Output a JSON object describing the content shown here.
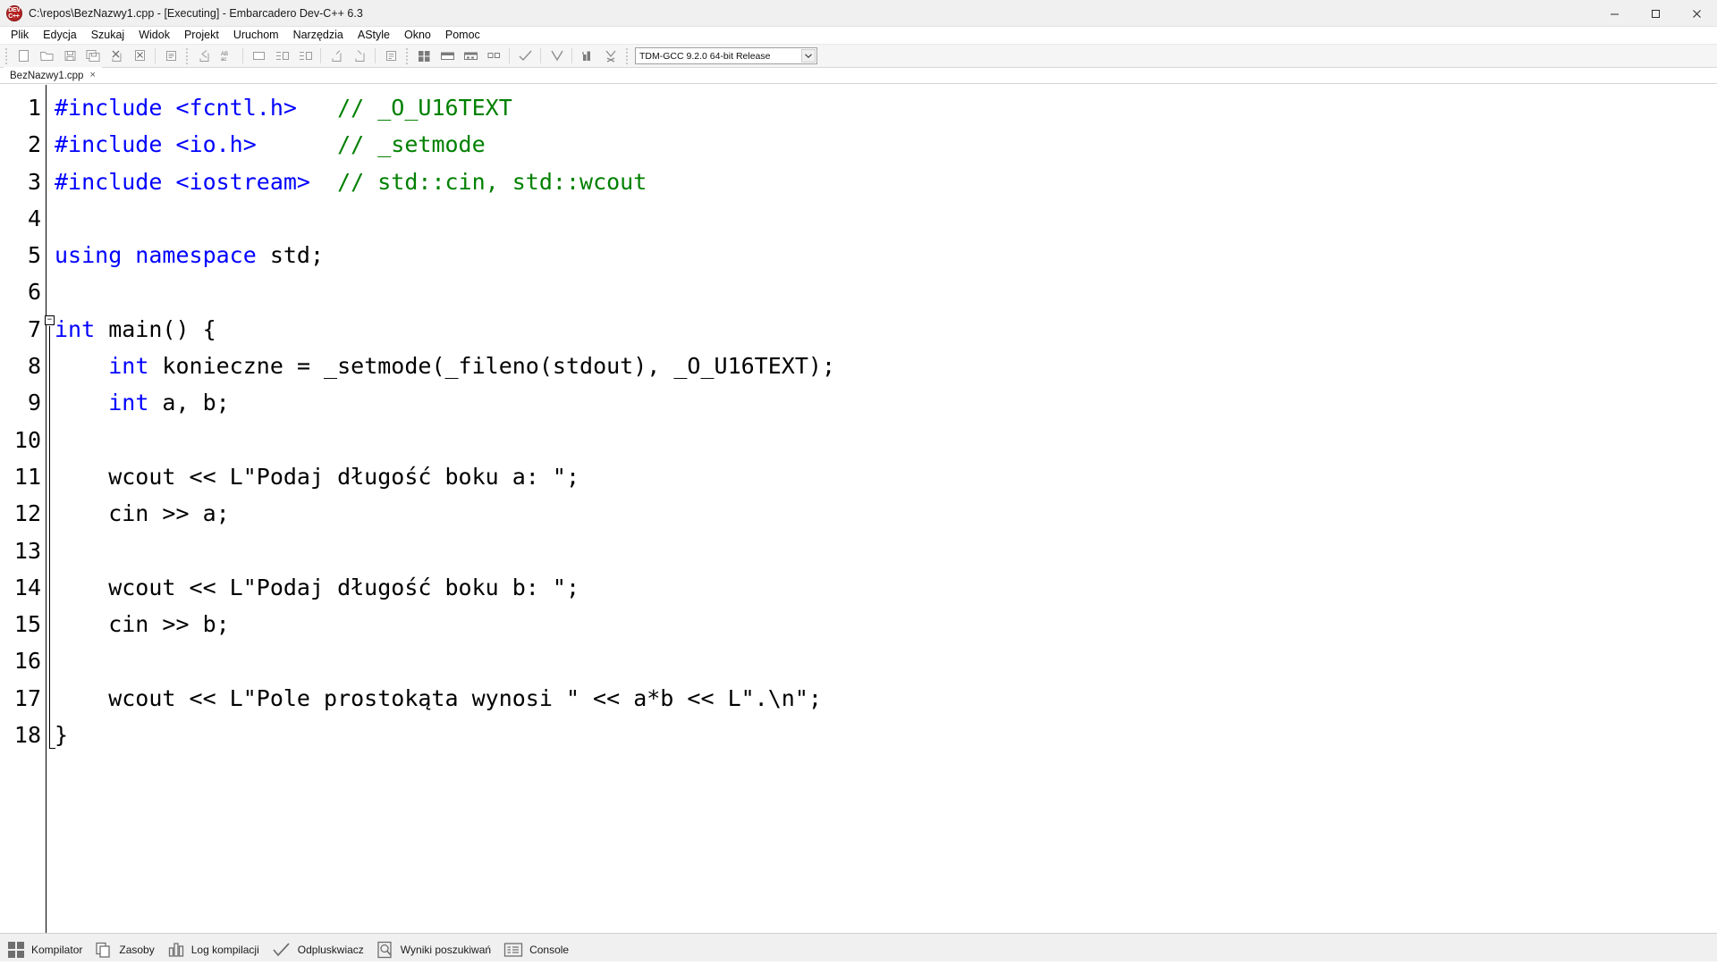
{
  "window": {
    "title": "C:\\repos\\BezNazwy1.cpp - [Executing] - Embarcadero Dev-C++ 6.3",
    "app_icon": "dev-cpp-logo-icon",
    "controls": {
      "minimize": "minimize-icon",
      "maximize": "maximize-icon",
      "close": "close-icon"
    }
  },
  "menubar": {
    "items": [
      {
        "label": "Plik"
      },
      {
        "label": "Edycja"
      },
      {
        "label": "Szukaj"
      },
      {
        "label": "Widok"
      },
      {
        "label": "Projekt"
      },
      {
        "label": "Uruchom"
      },
      {
        "label": "Narzędzia"
      },
      {
        "label": "AStyle"
      },
      {
        "label": "Okno"
      },
      {
        "label": "Pomoc"
      }
    ]
  },
  "toolbar": {
    "buttons": [
      {
        "name": "new-file-button",
        "icon": "new-file-icon"
      },
      {
        "name": "open-file-button",
        "icon": "open-folder-icon"
      },
      {
        "name": "save-file-button",
        "icon": "save-icon"
      },
      {
        "name": "save-all-button",
        "icon": "save-all-icon"
      },
      {
        "name": "close-file-button",
        "icon": "close-file-icon"
      },
      {
        "name": "close-all-button",
        "icon": "close-all-icon"
      },
      {
        "name": "print-button",
        "icon": "print-icon"
      },
      {
        "name": "undo-button",
        "icon": "undo-arrow-icon"
      },
      {
        "name": "redo-button",
        "icon": "redo-arrow-icon"
      },
      {
        "name": "find-button",
        "icon": "find-icon"
      },
      {
        "name": "replace-button",
        "icon": "replace-abc-icon"
      },
      {
        "name": "goto-line-button",
        "icon": "goto-line-icon"
      },
      {
        "name": "indent-button",
        "icon": "indent-icon"
      },
      {
        "name": "unindent-button",
        "icon": "unindent-icon"
      },
      {
        "name": "toggle-bookmark-button",
        "icon": "bookmark-icon"
      },
      {
        "name": "compile-button",
        "icon": "compile-icon"
      },
      {
        "name": "run-button",
        "icon": "run-icon"
      },
      {
        "name": "compile-and-run-button",
        "icon": "compile-run-icon"
      },
      {
        "name": "rebuild-all-button",
        "icon": "rebuild-icon"
      },
      {
        "name": "check-syntax-button",
        "icon": "checkmark-icon"
      },
      {
        "name": "stop-execution-button",
        "icon": "stop-x-icon"
      },
      {
        "name": "profile-button",
        "icon": "profile-chart-icon"
      },
      {
        "name": "debug-button",
        "icon": "debug-bug-icon"
      }
    ],
    "compiler_select": {
      "value": "TDM-GCC 9.2.0 64-bit Release",
      "arrow_icon": "chevron-down-icon"
    }
  },
  "tabs": [
    {
      "label": "BezNazwy1.cpp",
      "close": "×",
      "active": true
    }
  ],
  "editor": {
    "lines": [
      {
        "n": "1",
        "tokens": [
          {
            "t": "pre",
            "s": "#include <fcntl.h>"
          },
          {
            "t": "txt",
            "s": "   "
          },
          {
            "t": "cmt",
            "s": "// _O_U16TEXT"
          }
        ]
      },
      {
        "n": "2",
        "tokens": [
          {
            "t": "pre",
            "s": "#include <io.h>"
          },
          {
            "t": "txt",
            "s": "      "
          },
          {
            "t": "cmt",
            "s": "// _setmode"
          }
        ]
      },
      {
        "n": "3",
        "tokens": [
          {
            "t": "pre",
            "s": "#include <iostream>"
          },
          {
            "t": "txt",
            "s": "  "
          },
          {
            "t": "cmt",
            "s": "// std::cin, std::wcout"
          }
        ]
      },
      {
        "n": "4",
        "tokens": []
      },
      {
        "n": "5",
        "tokens": [
          {
            "t": "kw",
            "s": "using namespace"
          },
          {
            "t": "txt",
            "s": " std;"
          }
        ]
      },
      {
        "n": "6",
        "tokens": []
      },
      {
        "n": "7",
        "tokens": [
          {
            "t": "kw",
            "s": "int"
          },
          {
            "t": "txt",
            "s": " main() {"
          }
        ]
      },
      {
        "n": "8",
        "tokens": [
          {
            "t": "txt",
            "s": "    "
          },
          {
            "t": "kw",
            "s": "int"
          },
          {
            "t": "txt",
            "s": " konieczne = _setmode(_fileno(stdout), _O_U16TEXT);"
          }
        ]
      },
      {
        "n": "9",
        "tokens": [
          {
            "t": "txt",
            "s": "    "
          },
          {
            "t": "kw",
            "s": "int"
          },
          {
            "t": "txt",
            "s": " a, b;"
          }
        ]
      },
      {
        "n": "10",
        "tokens": []
      },
      {
        "n": "11",
        "tokens": [
          {
            "t": "txt",
            "s": "    wcout << L\"Podaj długość boku a: \";"
          }
        ]
      },
      {
        "n": "12",
        "tokens": [
          {
            "t": "txt",
            "s": "    cin >> a;"
          }
        ]
      },
      {
        "n": "13",
        "tokens": []
      },
      {
        "n": "14",
        "tokens": [
          {
            "t": "txt",
            "s": "    wcout << L\"Podaj długość boku b: \";"
          }
        ]
      },
      {
        "n": "15",
        "tokens": [
          {
            "t": "txt",
            "s": "    cin >> b;"
          }
        ]
      },
      {
        "n": "16",
        "tokens": []
      },
      {
        "n": "17",
        "tokens": [
          {
            "t": "txt",
            "s": "    wcout << L\"Pole prostokąta wynosi \" << a*b << L\".\\n\";"
          }
        ]
      },
      {
        "n": "18",
        "tokens": [
          {
            "t": "txt",
            "s": "}"
          }
        ]
      }
    ],
    "fold_marker": {
      "line": 7,
      "glyph": "−"
    }
  },
  "statusbar": {
    "items": [
      {
        "label": "Kompilator",
        "icon": "compiler-grid-icon"
      },
      {
        "label": "Zasoby",
        "icon": "resources-stack-icon"
      },
      {
        "label": "Log kompilacji",
        "icon": "build-log-bars-icon"
      },
      {
        "label": "Odpluskwiacz",
        "icon": "debugger-check-icon"
      },
      {
        "label": "Wyniki poszukiwań",
        "icon": "search-results-icon"
      },
      {
        "label": "Console",
        "icon": "console-lines-icon"
      }
    ]
  },
  "colors": {
    "keyword": "#0000ff",
    "comment": "#008000",
    "text": "#000000",
    "titlebar_bg": "#f0f0f0",
    "toolbar_bg": "#f5f5f5",
    "statusbar_bg": "#f0f0f0",
    "editor_bg": "#ffffff"
  }
}
